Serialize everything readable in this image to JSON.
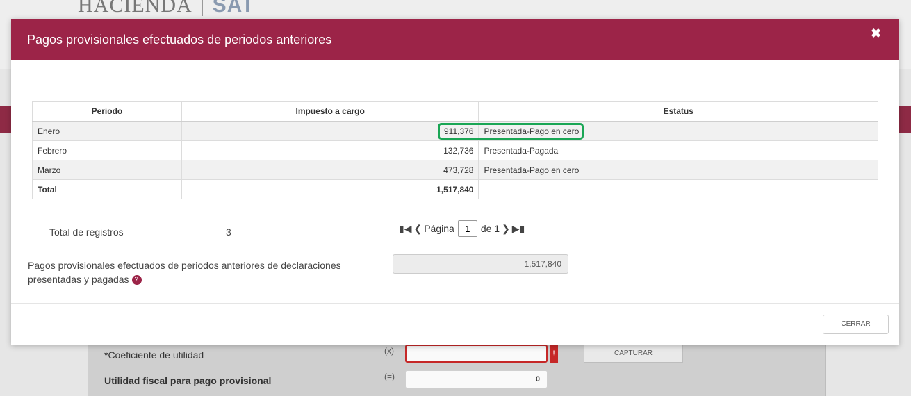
{
  "background": {
    "logo": {
      "hacienda": "HACIENDA",
      "sat": "SAT"
    },
    "fields": [
      {
        "label": "*Coeficiente de utilidad",
        "operator": "(x)",
        "value": ""
      },
      {
        "label": "Utilidad fiscal para pago provisional",
        "operator": "(=)",
        "value": "0"
      }
    ],
    "capture_button": "CAPTURAR",
    "error_marker": "!"
  },
  "modal": {
    "title": "Pagos provisionales efectuados de periodos anteriores",
    "close_icon": "✖",
    "table": {
      "headers": [
        "Periodo",
        "Impuesto a cargo",
        "Estatus"
      ],
      "rows": [
        {
          "periodo": "Enero",
          "impuesto": "911,376",
          "estatus": "Presentada-Pago en cero"
        },
        {
          "periodo": "Febrero",
          "impuesto": "132,736",
          "estatus": "Presentada-Pagada"
        },
        {
          "periodo": "Marzo",
          "impuesto": "473,728",
          "estatus": "Presentada-Pago en cero"
        }
      ],
      "total": {
        "label": "Total",
        "impuesto": "1,517,840",
        "estatus": ""
      }
    },
    "records": {
      "label": "Total de registros",
      "count": "3"
    },
    "pager": {
      "page_label": "Página",
      "current_page": "1",
      "of_label": "de 1"
    },
    "summary": {
      "label": "Pagos provisionales efectuados de periodos anteriores de declaraciones presentadas y pagadas",
      "value": "1,517,840"
    },
    "close_button": "CERRAR"
  },
  "colors": {
    "accent": "#9c2448",
    "highlight": "#1aa655"
  }
}
